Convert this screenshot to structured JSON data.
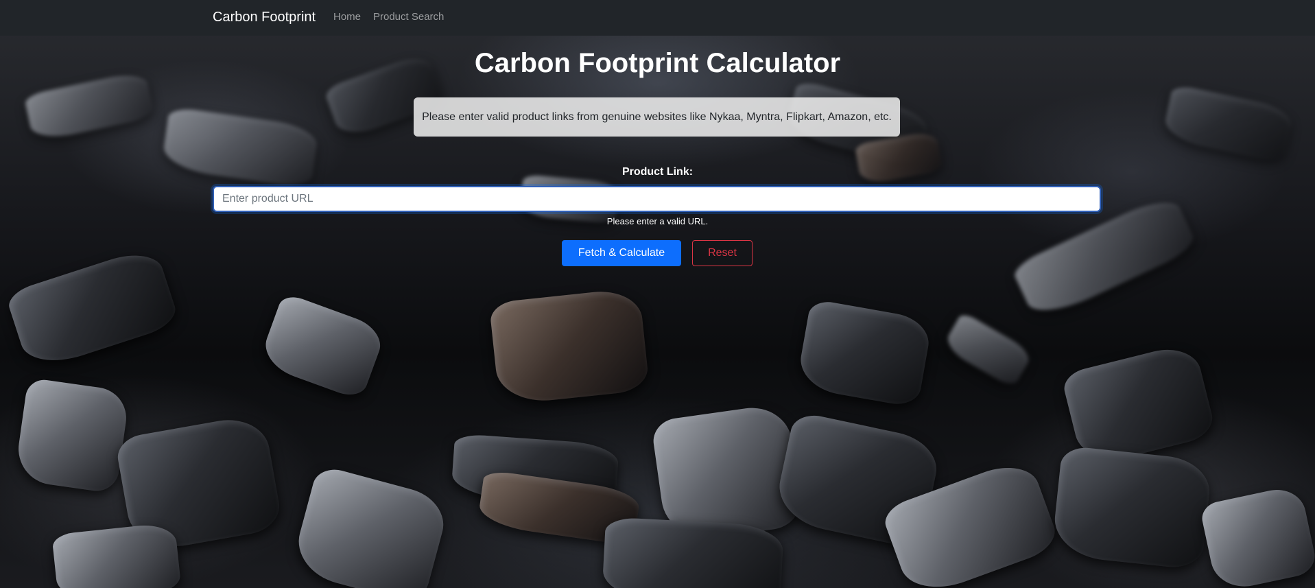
{
  "navbar": {
    "brand": "Carbon Footprint",
    "links": [
      {
        "label": "Home"
      },
      {
        "label": "Product Search"
      }
    ]
  },
  "main": {
    "title": "Carbon Footprint Calculator",
    "notice": "Please enter valid product links from genuine websites like Nykaa, Myntra, Flipkart, Amazon, etc.",
    "form": {
      "label": "Product Link:",
      "input": {
        "placeholder": "Enter product URL",
        "value": ""
      },
      "hint": "Please enter a valid URL.",
      "submit_label": "Fetch & Calculate",
      "reset_label": "Reset"
    }
  },
  "colors": {
    "navbar_bg": "#212529",
    "primary": "#0d6efd",
    "danger": "#dc3545"
  }
}
